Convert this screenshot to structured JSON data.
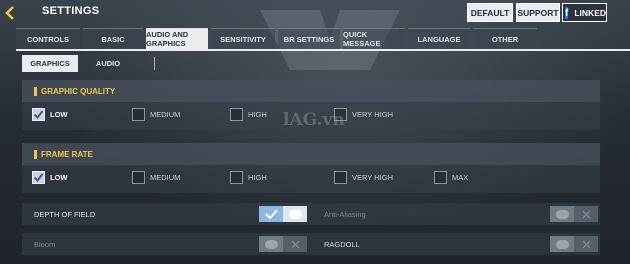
{
  "header": {
    "title": "SETTINGS",
    "buttons": {
      "default": "DEFAULT",
      "support": "SUPPORT",
      "linked": "LINKED"
    },
    "facebook_glyph": "f"
  },
  "tabs": [
    "CONTROLS",
    "BASIC",
    "AUDIO AND GRAPHICS",
    "SENSITIVITY",
    "BR SETTINGS",
    "QUICK MESSAGE",
    "LANGUAGE",
    "OTHER"
  ],
  "active_tab": "AUDIO AND GRAPHICS",
  "subtabs": [
    "GRAPHICS",
    "AUDIO"
  ],
  "active_subtab": "GRAPHICS",
  "graphic_quality": {
    "title": "GRAPHIC QUALITY",
    "options": [
      "LOW",
      "MEDIUM",
      "HIGH",
      "VERY HIGH"
    ],
    "selected": "LOW"
  },
  "frame_rate": {
    "title": "FRAME RATE",
    "options": [
      "LOW",
      "MEDIUM",
      "HIGH",
      "VERY HIGH",
      "MAX"
    ],
    "selected": "LOW"
  },
  "toggles": {
    "depth_of_field": {
      "label": "DEPTH OF FIELD",
      "on": true
    },
    "anti_aliasing": {
      "label": "Anti-Aliasing",
      "on": false
    },
    "bloom": {
      "label": "Bloom",
      "on": false
    },
    "ragdoll": {
      "label": "RAGDOLL",
      "on": false
    }
  },
  "watermark": "lAG.vn",
  "colors": {
    "accent_yellow": "#f3c744",
    "toggle_on": "#8fb6e3",
    "facebook": "#1877f2"
  }
}
